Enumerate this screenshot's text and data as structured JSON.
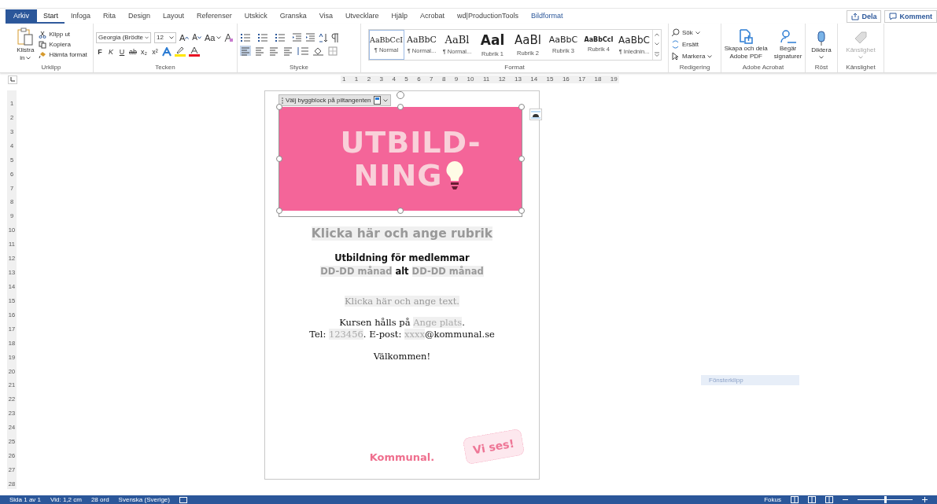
{
  "tabs": [
    {
      "label": "Arkiv",
      "kind": "file",
      "selected": false
    },
    {
      "label": "Start",
      "kind": "normal",
      "selected": true
    },
    {
      "label": "Infoga",
      "kind": "normal",
      "selected": false
    },
    {
      "label": "Rita",
      "kind": "normal",
      "selected": false
    },
    {
      "label": "Design",
      "kind": "normal",
      "selected": false
    },
    {
      "label": "Layout",
      "kind": "normal",
      "selected": false
    },
    {
      "label": "Referenser",
      "kind": "normal",
      "selected": false
    },
    {
      "label": "Utskick",
      "kind": "normal",
      "selected": false
    },
    {
      "label": "Granska",
      "kind": "normal",
      "selected": false
    },
    {
      "label": "Visa",
      "kind": "normal",
      "selected": false
    },
    {
      "label": "Utvecklare",
      "kind": "normal",
      "selected": false
    },
    {
      "label": "Hjälp",
      "kind": "normal",
      "selected": false
    },
    {
      "label": "Acrobat",
      "kind": "normal",
      "selected": false
    },
    {
      "label": "wd|ProductionTools",
      "kind": "normal",
      "selected": false
    },
    {
      "label": "Bildformat",
      "kind": "contextual",
      "selected": false
    }
  ],
  "share_buttons": [
    "Dela",
    "Komment"
  ],
  "clipboard": {
    "paste": "Klistra",
    "paste_2": "in",
    "items": [
      "Klipp ut",
      "Kopiera",
      "Hämta format"
    ],
    "label": "Urklipp"
  },
  "font": {
    "family": "Georgia (Brödte",
    "size": "12",
    "grow": "A",
    "shrink": "A",
    "case": "Aa",
    "format_buttons": [
      "F",
      "K",
      "U",
      "ab",
      "x₂",
      "x²"
    ],
    "label": "Tecken"
  },
  "paragraph": {
    "label": "Stycke"
  },
  "styles": {
    "items": [
      {
        "sample": "AaBbCcI",
        "name": "¶ Normal",
        "kind": "body",
        "selected": true
      },
      {
        "sample": "AaBbC",
        "name": "¶ Normal...",
        "kind": "body2",
        "selected": false
      },
      {
        "sample": "AaBl",
        "name": "¶ Normal...",
        "kind": "body3",
        "selected": false
      },
      {
        "sample": "Aal",
        "name": "Rubrik 1",
        "kind": "h1",
        "selected": false
      },
      {
        "sample": "AaBl",
        "name": "Rubrik 2",
        "kind": "h2",
        "selected": false
      },
      {
        "sample": "AaBbC",
        "name": "Rubrik 3",
        "kind": "h3",
        "selected": false
      },
      {
        "sample": "AaBbCcI",
        "name": "Rubrik 4",
        "kind": "h4",
        "selected": false
      },
      {
        "sample": "AaBbC",
        "name": "¶ Inlednin...",
        "kind": "intro",
        "selected": false
      }
    ],
    "label": "Format"
  },
  "editing": {
    "items": [
      "Sök",
      "Ersätt",
      "Markera"
    ],
    "label": "Redigering"
  },
  "acrobat": {
    "create": [
      "Skapa och dela",
      "Adobe PDF"
    ],
    "sign": [
      "Begär",
      "signaturer"
    ],
    "label": "Adobe Acrobat"
  },
  "voice": {
    "dictate": "Diktera",
    "label": "Röst"
  },
  "sensitivity": {
    "button": "Känslighet",
    "disabled": true,
    "label": "Känslighet"
  },
  "ruler": {
    "labels": [
      "1",
      "1",
      "2",
      "3",
      "4",
      "5",
      "6",
      "7",
      "8",
      "9",
      "10",
      "11",
      "12",
      "13",
      "14",
      "15",
      "16",
      "17",
      "18",
      "19"
    ]
  },
  "vertical_ruler": {
    "labels": [
      "1",
      "2",
      "3",
      "4",
      "5",
      "6",
      "7",
      "8",
      "9",
      "10",
      "11",
      "12",
      "13",
      "14",
      "15",
      "16",
      "17",
      "18",
      "19",
      "20",
      "21",
      "22",
      "23",
      "24",
      "25",
      "26",
      "27",
      "28"
    ]
  },
  "document": {
    "building_block_tag": "Välj byggblock på piltangenten",
    "banner_lines": [
      "UTBILD-",
      "NING"
    ],
    "heading": {
      "text": "Klicka här och ange rubrik",
      "placeholder": true
    },
    "subtitle": [
      {
        "text": "Utbildning för medlemmar ",
        "placeholder": false
      },
      {
        "text": "DD-DD månad",
        "placeholder": true
      },
      {
        "text": " alt ",
        "placeholder": false
      },
      {
        "text": "DD-DD månad",
        "placeholder": true
      }
    ],
    "intro": {
      "text": "Klicka här och ange text.",
      "placeholder": true
    },
    "info_lines": [
      [
        {
          "text": "Kursen hålls på ",
          "placeholder": false
        },
        {
          "text": "Ange plats",
          "placeholder": true
        },
        {
          "text": ".",
          "placeholder": false
        }
      ],
      [
        {
          "text": "Tel: ",
          "placeholder": false
        },
        {
          "text": "123456",
          "placeholder": true
        },
        {
          "text": ". E-post: ",
          "placeholder": false
        },
        {
          "text": "xxxx",
          "placeholder": true
        },
        {
          "text": "@kommunal.se",
          "placeholder": false
        }
      ]
    ],
    "closing": "Välkommen!",
    "sticker": "Vi ses!",
    "logo": "Kommunal."
  },
  "floating_hint": "Fönsterklipp",
  "status_bar": {
    "items": [
      "Sida 1 av 1",
      "Vid: 1,2 cm",
      "28 ord",
      "Svenska (Sverige)"
    ],
    "focus": "Fokus",
    "zoom": {
      "level": 0.5
    }
  }
}
